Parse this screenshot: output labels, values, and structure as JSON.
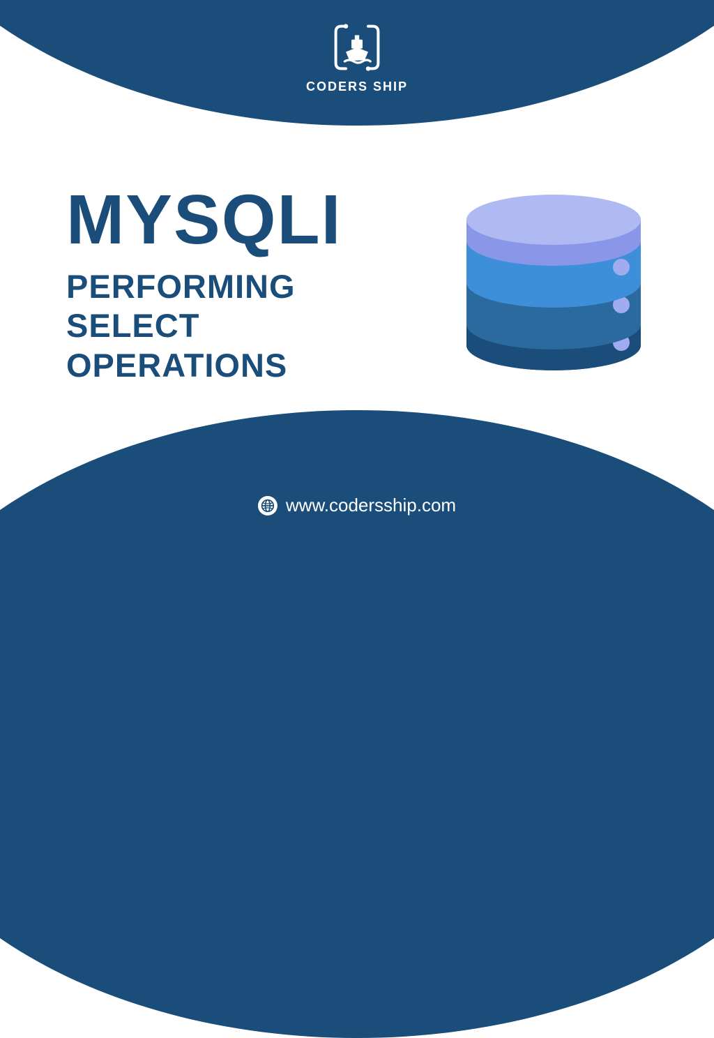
{
  "brand": {
    "name": "CODERS SHIP"
  },
  "heading": {
    "title": "MYSQLI",
    "subtitle_line1": "PERFORMING",
    "subtitle_line2": "SELECT",
    "subtitle_line3": "OPERATIONS"
  },
  "footer": {
    "website": "www.codersship.com"
  },
  "colors": {
    "primary": "#1a4d7a",
    "db_top": "#a0abf0",
    "db_mid_upper": "#3e8fd9",
    "db_mid_lower": "#2a6a9e",
    "db_bottom": "#1a4d7a",
    "db_dot": "#a0abf0"
  }
}
